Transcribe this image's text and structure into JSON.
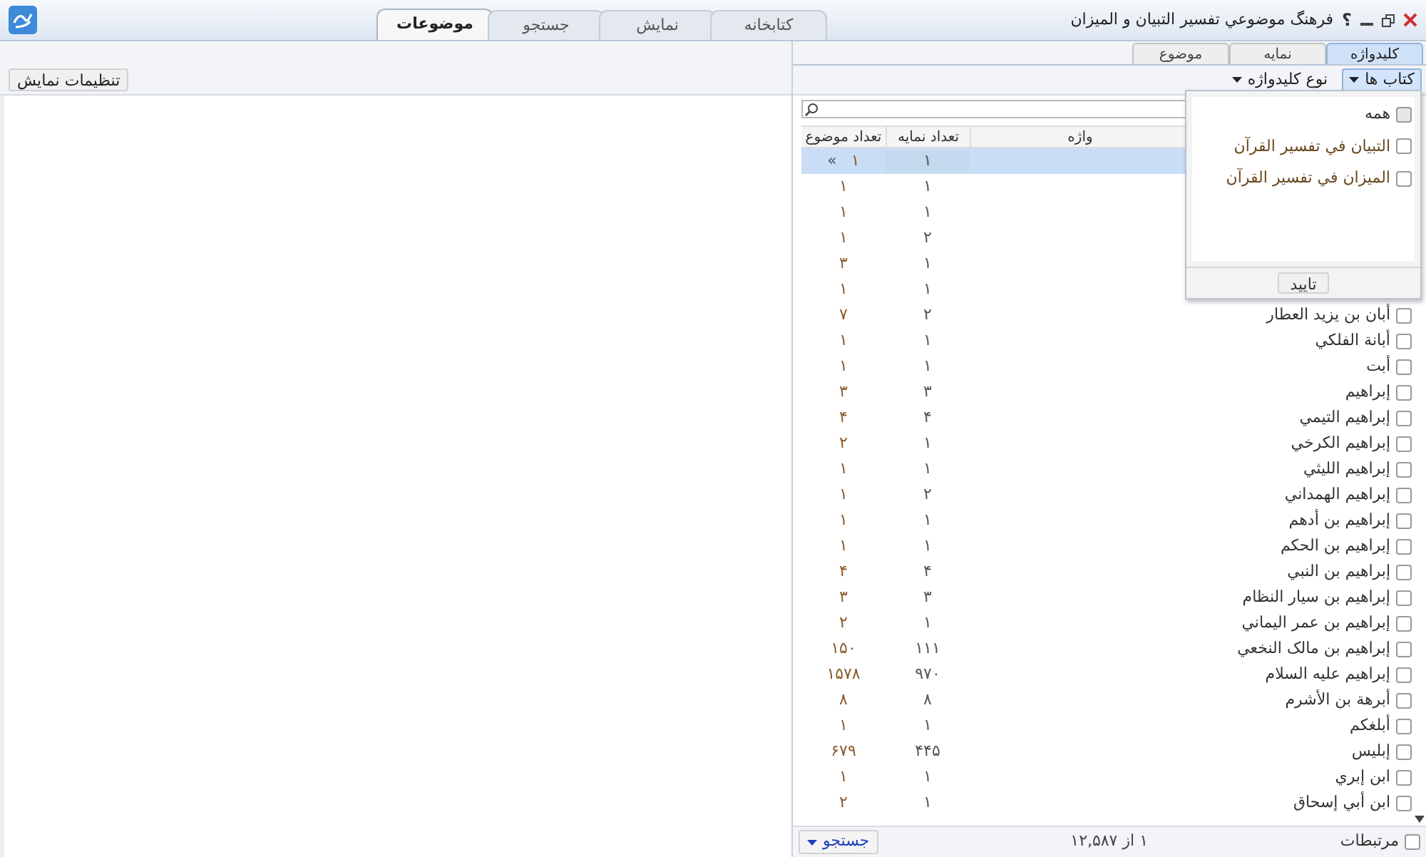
{
  "window": {
    "title": "فرهنگ موضوعي تفسير التبيان و الميزان",
    "help": "؟"
  },
  "main_tabs": [
    {
      "label": "کتابخانه",
      "selected": false
    },
    {
      "label": "نمایش",
      "selected": false
    },
    {
      "label": "جستجو",
      "selected": false
    },
    {
      "label": "موضوعات",
      "selected": true
    }
  ],
  "sub_tabs": [
    {
      "label": "کلیدواژه",
      "selected": true
    },
    {
      "label": "نمایه",
      "selected": false
    },
    {
      "label": "موضوع",
      "selected": false
    }
  ],
  "toolbar": {
    "books_button": "کتاب ها",
    "keyword_type": "نوع کلیدواژه",
    "display_settings": "تنظیمات نمایش"
  },
  "table": {
    "columns": [
      "واژه",
      "تعداد نمایه",
      "تعداد موضوع"
    ],
    "rows": [
      {
        "index_count": "۱",
        "topic_count": "۱",
        "selected": true,
        "marker": "»"
      },
      {
        "index_count": "۱",
        "topic_count": "۱",
        "selected": false
      },
      {
        "index_count": "۱",
        "topic_count": "۱",
        "selected": false
      },
      {
        "index_count": "۲",
        "topic_count": "۱",
        "selected": false
      },
      {
        "index_count": "۱",
        "topic_count": "۳",
        "selected": false
      },
      {
        "index_count": "۱",
        "topic_count": "۱",
        "selected": false
      },
      {
        "name": "أبان بن يزيد العطار",
        "index_count": "۲",
        "topic_count": "۷",
        "selected": false,
        "checked": false
      },
      {
        "name": "أبانة الفلكي",
        "index_count": "۱",
        "topic_count": "۱",
        "selected": false,
        "checked": false
      },
      {
        "name": "أبت",
        "index_count": "۱",
        "topic_count": "۱",
        "selected": false,
        "checked": false
      },
      {
        "name": "إبراهيم",
        "index_count": "۳",
        "topic_count": "۳",
        "selected": false,
        "checked": false
      },
      {
        "name": "إبراهيم التيمي",
        "index_count": "۴",
        "topic_count": "۴",
        "selected": false,
        "checked": false
      },
      {
        "name": "إبراهيم الكرخي",
        "index_count": "۱",
        "topic_count": "۲",
        "selected": false,
        "checked": false
      },
      {
        "name": "إبراهيم الليثي",
        "index_count": "۱",
        "topic_count": "۱",
        "selected": false,
        "checked": false
      },
      {
        "name": "إبراهيم الهمداني",
        "index_count": "۲",
        "topic_count": "۱",
        "selected": false,
        "checked": false
      },
      {
        "name": "إبراهيم بن أدهم",
        "index_count": "۱",
        "topic_count": "۱",
        "selected": false,
        "checked": false
      },
      {
        "name": "إبراهيم بن الحكم",
        "index_count": "۱",
        "topic_count": "۱",
        "selected": false,
        "checked": false
      },
      {
        "name": "إبراهيم بن النبي",
        "index_count": "۴",
        "topic_count": "۴",
        "selected": false,
        "checked": false
      },
      {
        "name": "إبراهيم بن سيار النظام",
        "index_count": "۳",
        "topic_count": "۳",
        "selected": false,
        "checked": false
      },
      {
        "name": "إبراهيم بن عمر اليماني",
        "index_count": "۱",
        "topic_count": "۲",
        "selected": false,
        "checked": false
      },
      {
        "name": "إبراهيم بن مالک النخعي",
        "index_count": "۱۱۱",
        "topic_count": "۱۵۰",
        "selected": false,
        "checked": false
      },
      {
        "name": "إبراهيم عليه السلام",
        "index_count": "۹۷۰",
        "topic_count": "۱۵۷۸",
        "selected": false,
        "checked": false
      },
      {
        "name": "أبرهة بن الأشرم",
        "index_count": "۸",
        "topic_count": "۸",
        "selected": false,
        "checked": false
      },
      {
        "name": "أبلغكم",
        "index_count": "۱",
        "topic_count": "۱",
        "selected": false,
        "checked": false
      },
      {
        "name": "إبليس",
        "index_count": "۴۴۵",
        "topic_count": "۶۷۹",
        "selected": false,
        "checked": false
      },
      {
        "name": "ابن إبري",
        "index_count": "۱",
        "topic_count": "۱",
        "selected": false,
        "checked": false
      },
      {
        "name": "ابن أبي إسحاق",
        "index_count": "۱",
        "topic_count": "۲",
        "selected": false,
        "checked": false
      }
    ]
  },
  "books_popup": {
    "items": [
      {
        "label": "همه",
        "checked": false,
        "kind": "all"
      },
      {
        "label": "التبيان في تفسير القرآن",
        "checked": false,
        "kind": "book"
      },
      {
        "label": "الميزان في تفسير القرآن",
        "checked": false,
        "kind": "book"
      }
    ],
    "confirm": "تایید"
  },
  "footer": {
    "related_label": "مرتبطات",
    "related_checked": false,
    "paging": "۱ از ۱۲,۵۸۷",
    "search_button": "جستجو"
  }
}
